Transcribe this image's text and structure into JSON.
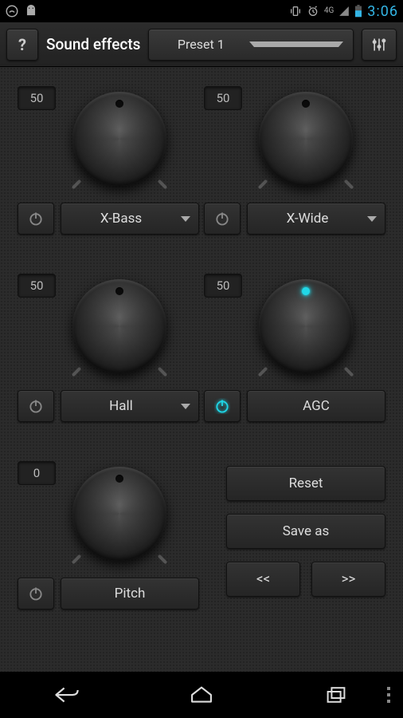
{
  "status": {
    "clock": "3:06",
    "network": "4G"
  },
  "header": {
    "title": "Sound effects",
    "preset_selected": "Preset 1"
  },
  "knobs": [
    {
      "id": "xbass",
      "value": "50",
      "label": "X-Bass",
      "power_on": false,
      "lit": false,
      "has_dropdown": true
    },
    {
      "id": "xwide",
      "value": "50",
      "label": "X-Wide",
      "power_on": false,
      "lit": false,
      "has_dropdown": true
    },
    {
      "id": "hall",
      "value": "50",
      "label": "Hall",
      "power_on": false,
      "lit": false,
      "has_dropdown": true
    },
    {
      "id": "agc",
      "value": "50",
      "label": "AGC",
      "power_on": true,
      "lit": true,
      "has_dropdown": false
    },
    {
      "id": "pitch",
      "value": "0",
      "label": "Pitch",
      "power_on": false,
      "lit": false,
      "has_dropdown": false
    }
  ],
  "actions": {
    "reset": "Reset",
    "save_as": "Save as",
    "prev": "<<",
    "next": ">>"
  }
}
